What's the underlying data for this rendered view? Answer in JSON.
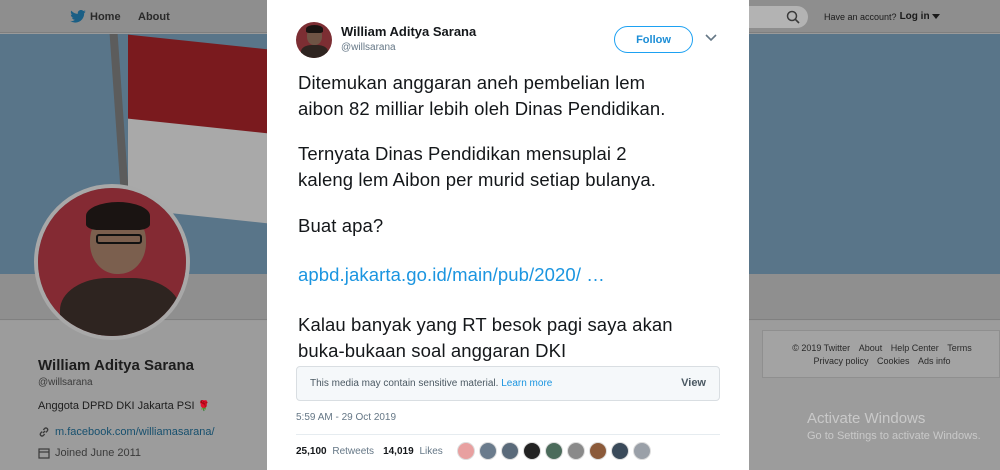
{
  "nav": {
    "home_label": "Home",
    "about_label": "About",
    "account_prompt": "Have an account?",
    "login_label": "Log in"
  },
  "profile": {
    "name": "William Aditya Sarana",
    "handle": "@willsarana",
    "bio": "Anggota DPRD DKI Jakarta PSI",
    "bio_emoji": "🌹",
    "link": "m.facebook.com/williamasarana/",
    "joined": "Joined June 2011"
  },
  "footer": {
    "row1": [
      "© 2019 Twitter",
      "About",
      "Help Center",
      "Terms"
    ],
    "row2": [
      "Privacy policy",
      "Cookies",
      "Ads info"
    ]
  },
  "windows_watermark": {
    "title": "Activate Windows",
    "subtitle": "Go to Settings to activate Windows."
  },
  "tweet": {
    "author_name": "William Aditya Sarana",
    "author_handle": "@willsarana",
    "follow_label": "Follow",
    "paragraph1_line1": "Ditemukan anggaran aneh pembelian lem",
    "paragraph1_line2": "aibon 82 milliar lebih oleh Dinas Pendidikan.",
    "paragraph2_line1": "Ternyata Dinas Pendidikan mensuplai 2",
    "paragraph2_line2": "kaleng lem Aibon per murid setiap bulanya.",
    "paragraph3": "Buat apa?",
    "link_text": "apbd.jakarta.go.id/main/pub/2020/  …",
    "paragraph4_line1": "Kalau banyak yang RT besok pagi saya akan",
    "paragraph4_line2": "buka-bukaan soal anggaran DKI",
    "media_warning": "This media may contain sensitive material.",
    "learn_more": "Learn more",
    "view_label": "View",
    "timestamp": "5:59 AM - 29 Oct 2019",
    "retweets_count": "25,100",
    "retweets_label": "Retweets",
    "likes_count": "14,019",
    "likes_label": "Likes",
    "liker_avatar_colors": [
      "#e8a0a0",
      "#6a7b8c",
      "#5a6a7a",
      "#222222",
      "#4b6b5b",
      "#8a8a8a",
      "#8b5a3a",
      "#3a4a5a",
      "#9aa0a8"
    ]
  },
  "colors": {
    "twitter_blue": "#1da1f2",
    "link_blue": "#1b95e0",
    "text_dark": "#14171a",
    "text_muted": "#657786"
  }
}
